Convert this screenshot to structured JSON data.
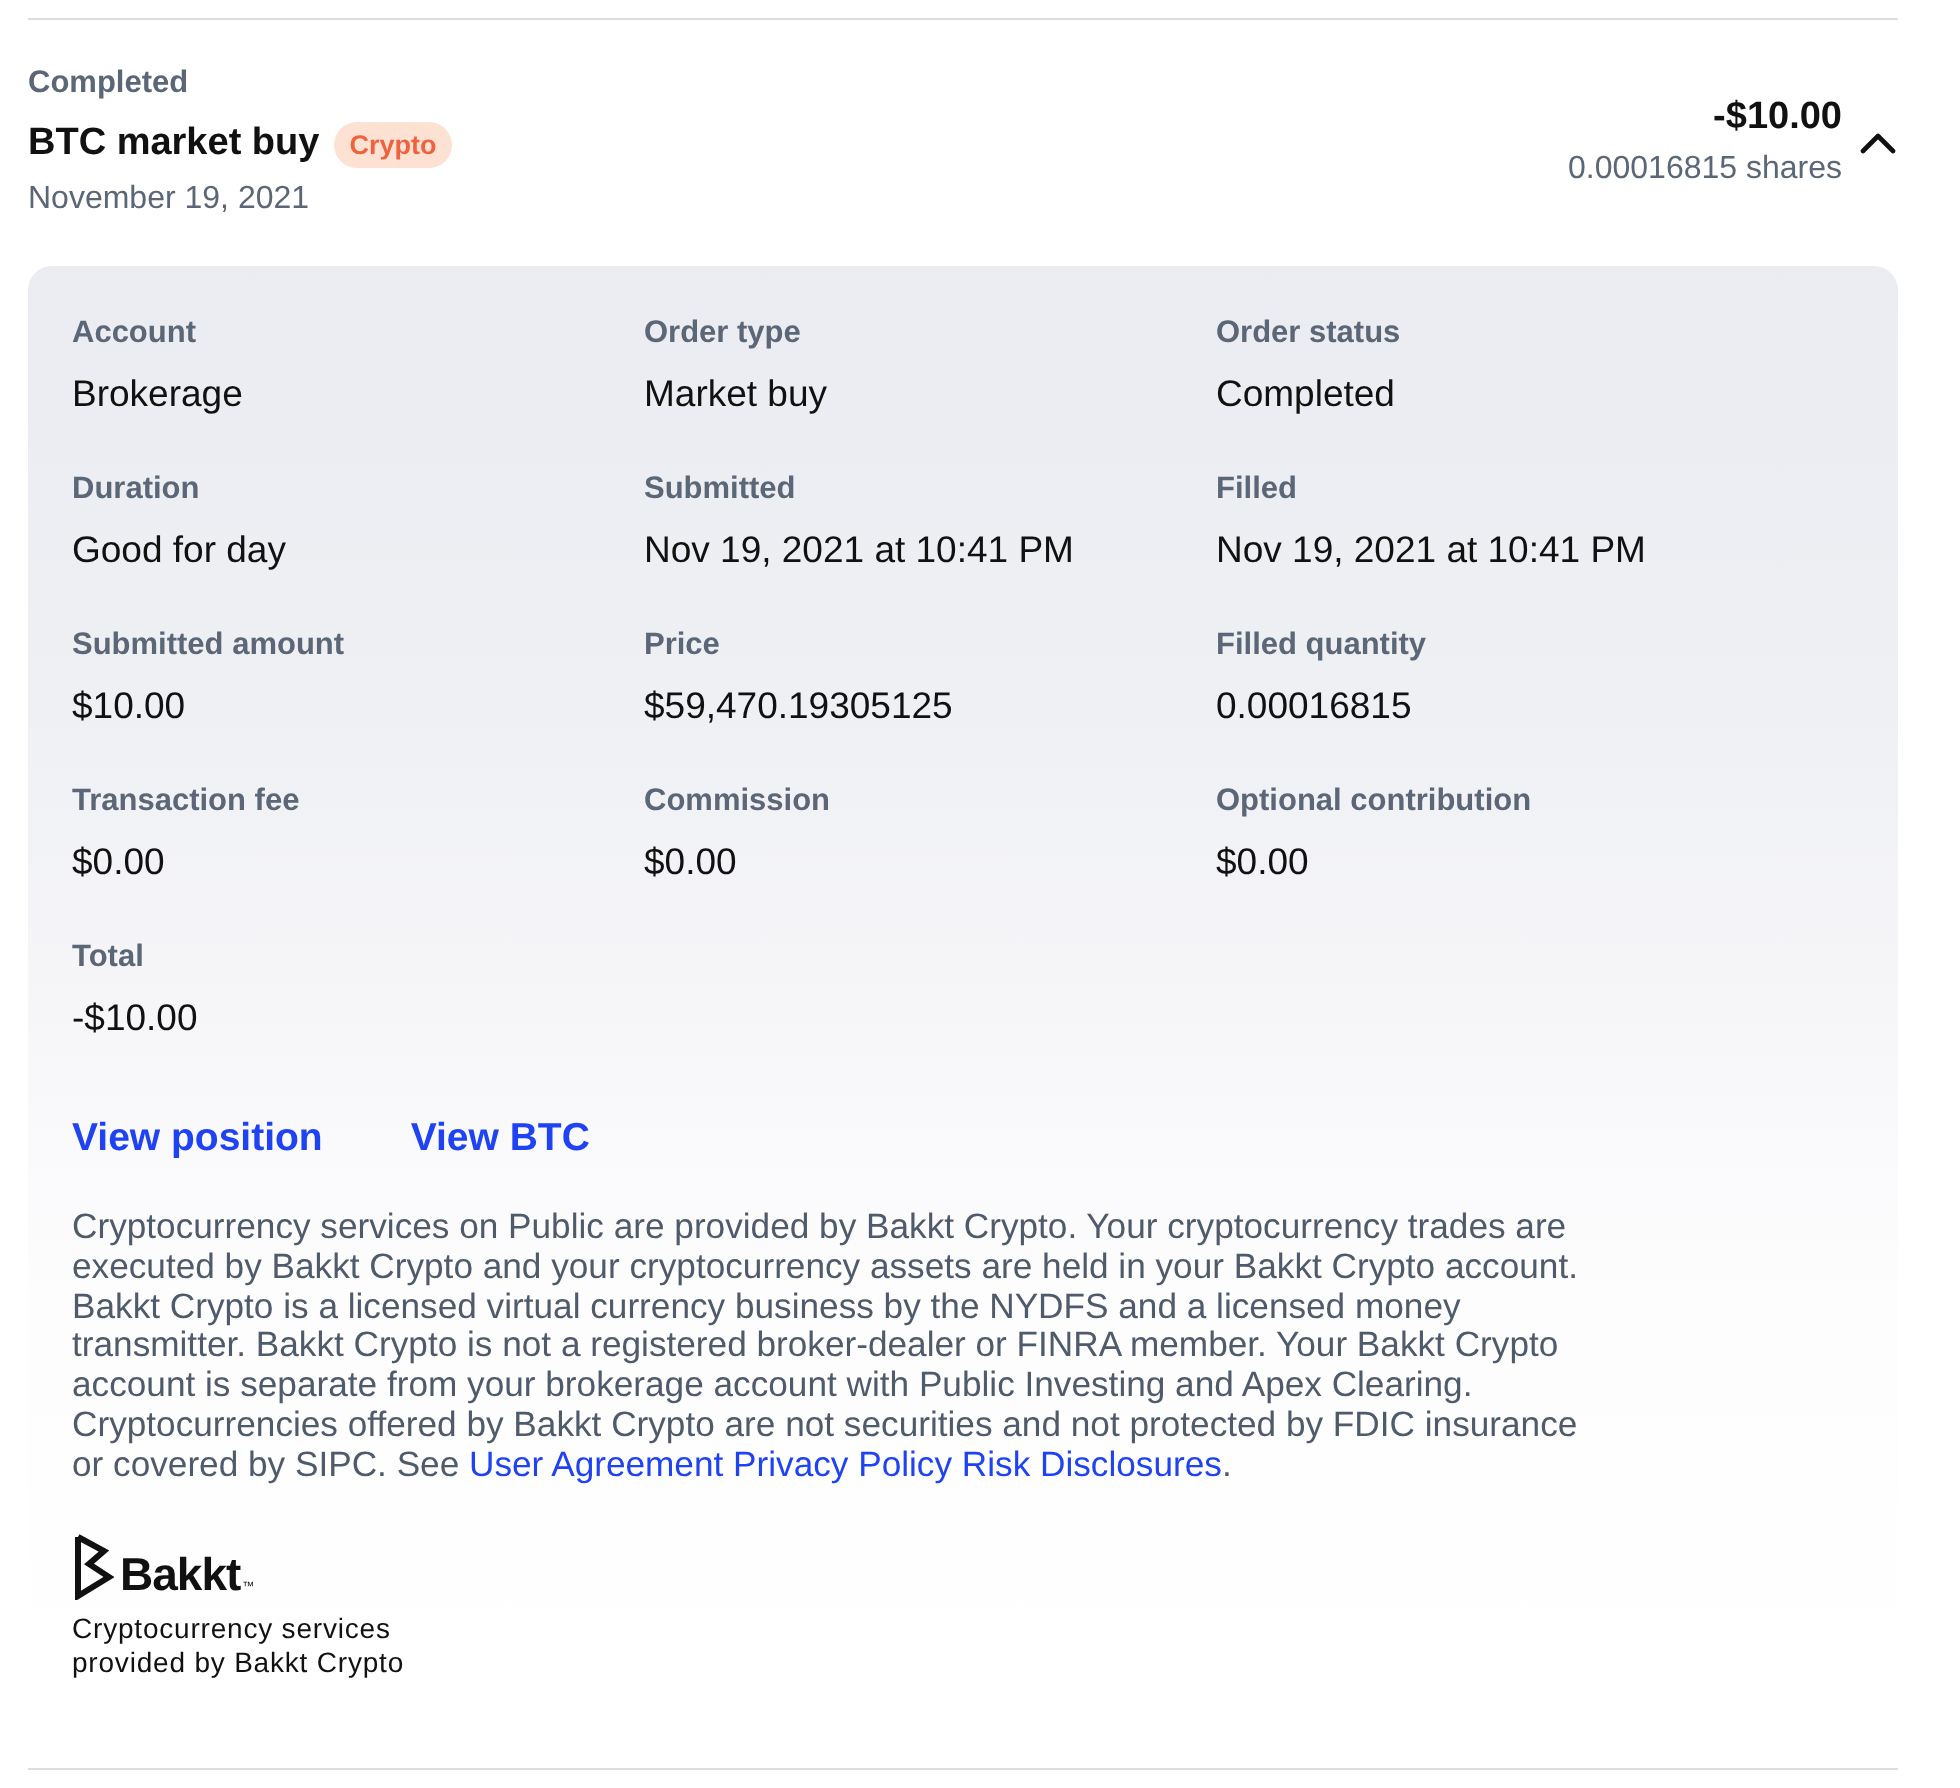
{
  "order": {
    "status": "Completed",
    "title": "BTC market buy",
    "tag": "Crypto",
    "date": "November 19, 2021",
    "amount": "-$10.00",
    "shares": "0.00016815 shares",
    "expanded": true
  },
  "details": [
    {
      "label": "Account",
      "value": "Brokerage"
    },
    {
      "label": "Order type",
      "value": "Market buy"
    },
    {
      "label": "Order status",
      "value": "Completed"
    },
    {
      "label": "Duration",
      "value": "Good for day"
    },
    {
      "label": "Submitted",
      "value": "Nov 19, 2021 at 10:41 PM"
    },
    {
      "label": "Filled",
      "value": "Nov 19, 2021 at 10:41 PM"
    },
    {
      "label": "Submitted amount",
      "value": "$10.00"
    },
    {
      "label": "Price",
      "value": "$59,470.19305125"
    },
    {
      "label": "Filled quantity",
      "value": "0.00016815"
    },
    {
      "label": "Transaction fee",
      "value": "$0.00"
    },
    {
      "label": "Commission",
      "value": "$0.00"
    },
    {
      "label": "Optional contribution",
      "value": "$0.00"
    },
    {
      "label": "Total",
      "value": "-$10.00"
    }
  ],
  "links": [
    "View position",
    "View BTC"
  ],
  "disclaimer": {
    "text": "Cryptocurrency services on Public are provided by Bakkt Crypto. Your cryptocurrency trades are executed by Bakkt Crypto and your cryptocurrency assets are held in your Bakkt Crypto account. Bakkt Crypto is a licensed virtual currency business by the NYDFS and a licensed money transmitter. Bakkt Crypto is not a registered broker-dealer or FINRA member. Your Bakkt Crypto account is separate from your brokerage account with Public Investing and Apex Clearing. Cryptocurrencies offered by Bakkt Crypto are not securities and not protected by FDIC insurance or covered by SIPC. See",
    "links": [
      "User Agreement",
      "Privacy Policy",
      "Risk Disclosures"
    ],
    "end": "."
  },
  "provider": {
    "logo": "Bakkt",
    "trademark": "™",
    "caption": "Cryptocurrency services provided by Bakkt Crypto"
  }
}
